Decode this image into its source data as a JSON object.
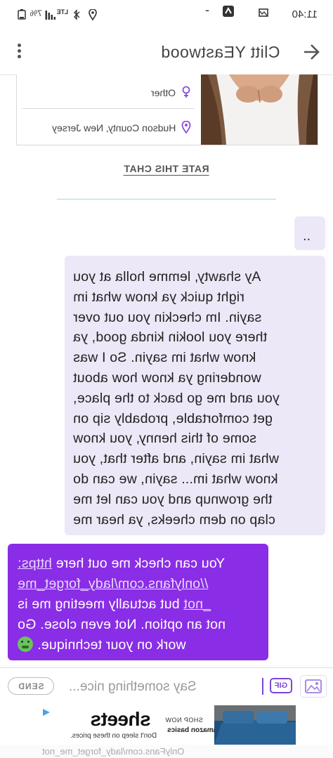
{
  "status_bar": {
    "time": "11:40",
    "network": "LTE",
    "battery": "7%"
  },
  "header": {
    "title": "Clitt YEastwood",
    "back_icon": "arrow-back-icon",
    "menu_icon": "more-vertical-icon"
  },
  "profile": {
    "gender": "Other",
    "location": "Hudson County, New Jersey"
  },
  "rate_chat_label": "RATE THIS CHAT",
  "messages": {
    "dots": "..",
    "long_lines": [
      "Ay shawty, lemme holla at you",
      "right quick ya know what im",
      "sayin. Im checkin you out over",
      "there you lookin kinda good, ya",
      "know what im sayin. So I was",
      "wondering ya know how about",
      "you and me go back to the place,",
      "get comfortable, probably sip on",
      "some of this henny, you know",
      "what im sayin, and after that, you",
      "know what im... sayin, we can do",
      "the grownup and you can let me",
      "clap on dem cheeks, ya hear me"
    ],
    "reply": {
      "lead": "You can check me out here ",
      "link_a": "https:",
      "link_b": "//onlyfans.com/lady_forget_me",
      "link_c": "_not",
      "rest_1": " but actually meeting me is",
      "rest_2": "not an option. Not even close. Go",
      "rest_3": "work on your technique.",
      "emoji": "nauseated-face-icon"
    }
  },
  "composer": {
    "placeholder": "Say something nice...",
    "gif_label": "GIF",
    "send_label": "SEND"
  },
  "ad": {
    "headline": "sheets",
    "tagline": "Don't sleep on these prices.",
    "shop": "SHOP NOW",
    "brand": "amazon basics"
  },
  "watermark": "OnlyFans.com/lady_forget_me_not",
  "colors": {
    "bubble_light": "#ece8f7",
    "bubble_purple": "#8a2de6",
    "accent": "#7b46d9",
    "divider_teal": "#8ee3dd"
  }
}
